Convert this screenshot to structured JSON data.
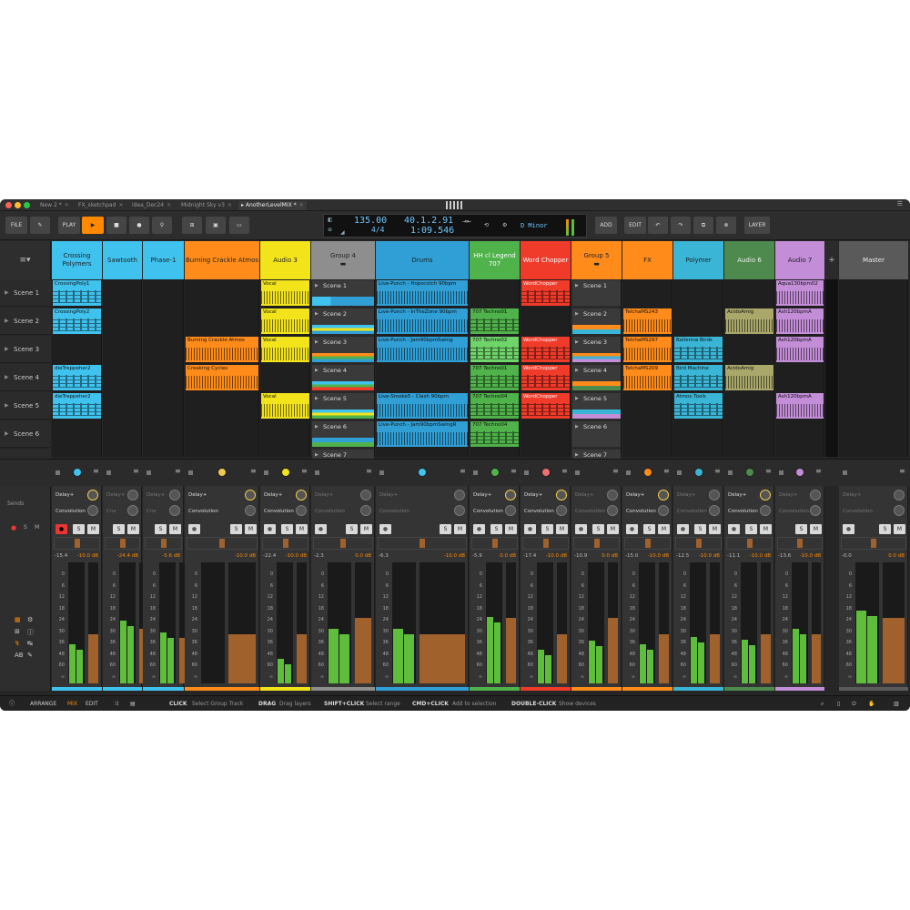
{
  "tabs": [
    "New 2 *",
    "FX_sketchpad",
    "idea_Dec24",
    "Midnight Sky v3",
    "AnotherLevelMIX *"
  ],
  "toolbar": {
    "file": "FILE",
    "play": "PLAY",
    "add": "ADD",
    "edit": "EDIT",
    "layer": "LAYER",
    "tempo": "135.00",
    "position": "40.1.2.91",
    "time_sig": "4/4",
    "time": "1:09.546",
    "key": "D Minor"
  },
  "tracks": [
    {
      "name": "Crossing Polymers",
      "color": "#3fc2ee"
    },
    {
      "name": "Sawtooth",
      "color": "#3fc2ee"
    },
    {
      "name": "Phase-1",
      "color": "#3fc2ee"
    },
    {
      "name": "Burning Crackle Atmos",
      "color": "#ff8c1a"
    },
    {
      "name": "Audio 3",
      "color": "#f2e31b"
    },
    {
      "name": "Group 4",
      "color": "#8e8e8e"
    },
    {
      "name": "Drums",
      "color": "#2f9fd6"
    },
    {
      "name": "HH cl Legend 707",
      "color": "#4fb24a"
    },
    {
      "name": "Word Chopper",
      "color": "#f03a2a"
    },
    {
      "name": "Group 5",
      "color": "#ff8c1a"
    },
    {
      "name": "FX",
      "color": "#ff8c1a"
    },
    {
      "name": "Polymer",
      "color": "#3ab5d6"
    },
    {
      "name": "Audio 6",
      "color": "#4e8a4e"
    },
    {
      "name": "Audio 7",
      "color": "#c38dd8"
    },
    {
      "name": "Master",
      "color": "#5a5a5a"
    }
  ],
  "scenes": [
    "Scene 1",
    "Scene 2",
    "Scene 3",
    "Scene 4",
    "Scene 5",
    "Scene 6"
  ],
  "clips": {
    "c1": "CrossingPoly1",
    "c2": "CrossingPoly2",
    "c3": "dieTreppeher2",
    "c4": "dieTreppeher2",
    "b1": "Burning Crackle Atmos",
    "b2": "Creaking Cycles",
    "v1": "Vocal",
    "v2": "Vocal",
    "v3": "Vocal",
    "v4": "Vocal",
    "g4": [
      "Scene 1",
      "Scene 2",
      "Scene 3",
      "Scene 4",
      "Scene 5",
      "Scene 6",
      "Scene 7"
    ],
    "d1": "Live-Punch - Hopscotch 90bpm",
    "d2": "Live-Punch - InTheZone 90bpm",
    "d3": "Live-Punch - Jam90bpmSwing",
    "d5": "Live-Smoke5 - Clash 90bpm",
    "d6": "Live-Punch - Jam90bpmSwingR",
    "h2": "707 Techno01",
    "h3": "707 Techno02",
    "h4": "707 Techno01",
    "h5": "707 Techno04",
    "h6": "707 Techno04",
    "w1": "WordChopper",
    "w3": "WordChopper",
    "w4": "WordChopper",
    "w5": "WordChopper",
    "g5": [
      "Scene 1",
      "Scene 2",
      "Scene 3",
      "Scene 4",
      "Scene 5",
      "Scene 6",
      "Scene 7"
    ],
    "f2": "TelchaMS243",
    "f3": "TelchaMS297",
    "f4": "TelchaMS209",
    "p3": "Ballerina Birds",
    "p4": "Bird Machine",
    "p5": "Atmos Tools",
    "a2": "AcidoAmig",
    "a4": "AcidoAmig",
    "s1": "Aqua130bpm02",
    "s2": "Ash120bpmA",
    "s3": "Ash120bpmA",
    "s5": "Ash120bpmA"
  },
  "mixer": {
    "sends_label": "Sends",
    "send1": "Delay+",
    "send2": "Convolution",
    "send2b": "Cnv",
    "s": "S",
    "m": "M",
    "channels": [
      {
        "peak": "-15.4",
        "vol": "-10.0 dB",
        "level": 0.32,
        "fader": 0.54
      },
      {
        "peak": "",
        "vol": "-24.4 dB",
        "level": 0.52,
        "fader": 0.6
      },
      {
        "peak": "",
        "vol": "-5.6 dB",
        "level": 0.42,
        "fader": 0.5
      },
      {
        "peak": "",
        "vol": "-10.0 dB",
        "level": 0.0,
        "fader": 0.54
      },
      {
        "peak": "-22.4",
        "vol": "-10.0 dB",
        "level": 0.2,
        "fader": 0.54
      },
      {
        "peak": "-2.3",
        "vol": "0.0 dB",
        "level": 0.45,
        "fader": 0.72
      },
      {
        "peak": "-6.3",
        "vol": "-10.0 dB",
        "level": 0.45,
        "fader": 0.54
      },
      {
        "peak": "-5.9",
        "vol": "0.0 dB",
        "level": 0.55,
        "fader": 0.72
      },
      {
        "peak": "-17.4",
        "vol": "-10.0 dB",
        "level": 0.28,
        "fader": 0.54
      },
      {
        "peak": "-10.9",
        "vol": "0.0 dB",
        "level": 0.35,
        "fader": 0.72
      },
      {
        "peak": "-15.0",
        "vol": "-10.0 dB",
        "level": 0.32,
        "fader": 0.54
      },
      {
        "peak": "-12.5",
        "vol": "-10.0 dB",
        "level": 0.38,
        "fader": 0.54
      },
      {
        "peak": "-11.1",
        "vol": "-10.0 dB",
        "level": 0.36,
        "fader": 0.54
      },
      {
        "peak": "-13.6",
        "vol": "-10.0 dB",
        "level": 0.45,
        "fader": 0.54
      },
      {
        "peak": "-0.0",
        "vol": "0.0 dB",
        "level": 0.6,
        "fader": 0.72
      }
    ],
    "scale": [
      "0",
      "6",
      "12",
      "18",
      "24",
      "30",
      "36",
      "48",
      "60",
      "∞"
    ]
  },
  "status": {
    "arrange": "ARRANGE",
    "mix": "MIX",
    "edit": "EDIT",
    "h1k": "CLICK",
    "h1d": "Select Group Track",
    "h2k": "DRAG",
    "h2d": "Drag layers",
    "h3k": "SHIFT+CLICK",
    "h3d": "Select range",
    "h4k": "CMD+CLICK",
    "h4d": "Add to selection",
    "h5k": "DOUBLE-CLICK",
    "h5d": "Show devices"
  }
}
